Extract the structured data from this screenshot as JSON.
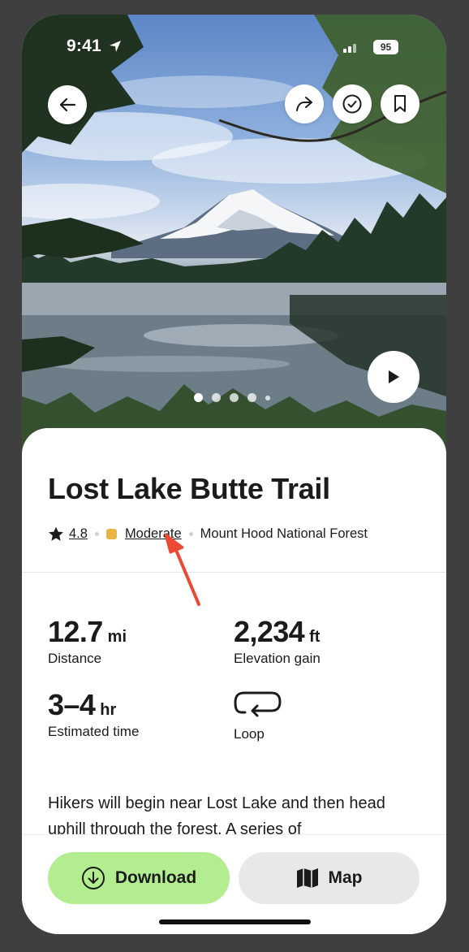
{
  "status_bar": {
    "time": "9:41",
    "battery": "95"
  },
  "hero": {
    "photo_description_icon": "mountain-lake-photo",
    "carousel": {
      "total_dots": 5,
      "active_index": 0
    }
  },
  "trail": {
    "title": "Lost Lake Butte Trail",
    "rating": "4.8",
    "difficulty": "Moderate",
    "difficulty_color": "#e9b545",
    "location": "Mount Hood National Forest"
  },
  "stats": {
    "distance": {
      "value": "12.7",
      "unit": "mi",
      "label": "Distance"
    },
    "elevation": {
      "value": "2,234",
      "unit": "ft",
      "label": "Elevation gain"
    },
    "time": {
      "value": "3–4",
      "unit": "hr",
      "label": "Estimated time"
    },
    "route": {
      "label": "Loop",
      "icon": "loop-icon"
    }
  },
  "description": "Hikers will begin near Lost Lake and then head uphill through the forest.  A series of",
  "actions": {
    "download_label": "Download",
    "map_label": "Map"
  },
  "colors": {
    "download_bg": "#b2ee8f",
    "map_bg": "#e8e8e6",
    "annotation_arrow": "#ea4a34"
  }
}
